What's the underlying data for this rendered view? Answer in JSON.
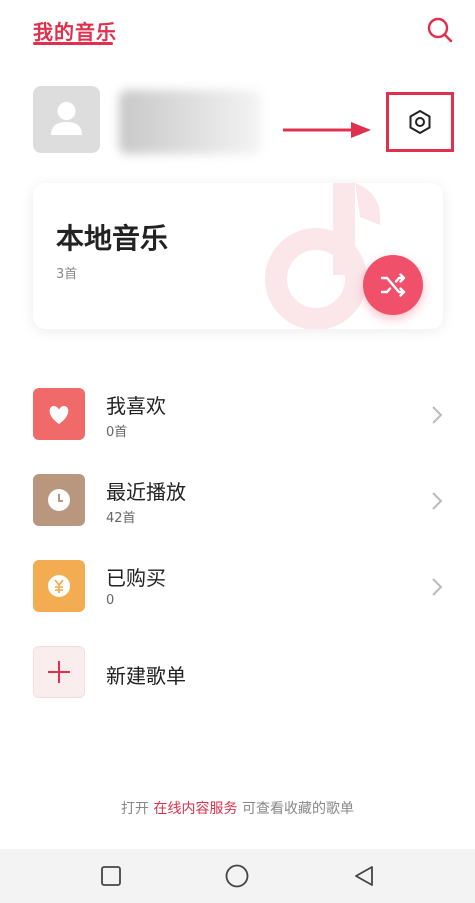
{
  "header": {
    "title": "我的音乐"
  },
  "local_music": {
    "title": "本地音乐",
    "count": "3首"
  },
  "list": [
    {
      "label": "我喜欢",
      "sub": "0首",
      "color": "#f06a6a"
    },
    {
      "label": "最近播放",
      "sub": "42首",
      "color": "#b9977e"
    },
    {
      "label": "已购买",
      "sub": "0",
      "color": "#f4ac52"
    }
  ],
  "new_playlist": {
    "label": "新建歌单"
  },
  "footer": {
    "prefix": "打开 ",
    "link": "在线内容服务",
    "suffix": " 可查看收藏的歌单"
  },
  "colors": {
    "accent": "#e0304e",
    "annotation": "#e0304e"
  }
}
